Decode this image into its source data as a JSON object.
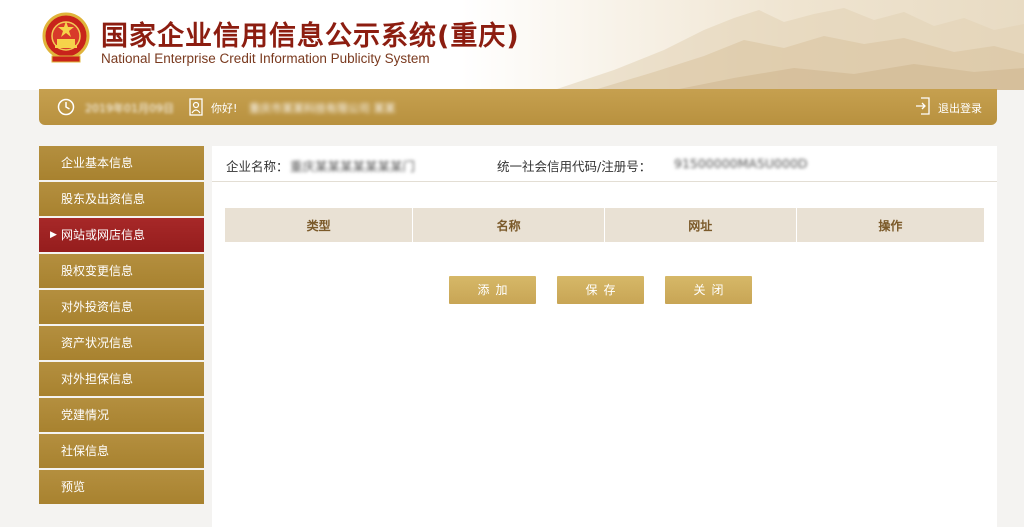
{
  "header": {
    "title": "国家企业信用信息公示系统(重庆)",
    "subtitle": "National Enterprise Credit Information Publicity System"
  },
  "topbar": {
    "date": "2019年01月09日",
    "greeting": "你好!",
    "user_name": "重庆市某某科技有限公司 某某",
    "logout_label": "退出登录"
  },
  "sidebar": {
    "items": [
      {
        "label": "企业基本信息",
        "active": false
      },
      {
        "label": "股东及出资信息",
        "active": false
      },
      {
        "label": "网站或网店信息",
        "active": true
      },
      {
        "label": "股权变更信息",
        "active": false
      },
      {
        "label": "对外投资信息",
        "active": false
      },
      {
        "label": "资产状况信息",
        "active": false
      },
      {
        "label": "对外担保信息",
        "active": false
      },
      {
        "label": "党建情况",
        "active": false
      },
      {
        "label": "社保信息",
        "active": false
      },
      {
        "label": "预览",
        "active": false
      }
    ]
  },
  "company": {
    "name_label": "企业名称：",
    "name_value": "重庆某某某某某某某门",
    "code_label": "统一社会信用代码/注册号：",
    "code_value": "91500000MA5U000D"
  },
  "table": {
    "headers": [
      "类型",
      "名称",
      "网址",
      "操作"
    ],
    "rows": []
  },
  "actions": {
    "add": "添加",
    "save": "保存",
    "close": "关闭"
  },
  "colors": {
    "gold": "#b8913f",
    "active_red": "#a72828",
    "title_red": "#8c1d10",
    "button_gold": "#cfae5e"
  }
}
